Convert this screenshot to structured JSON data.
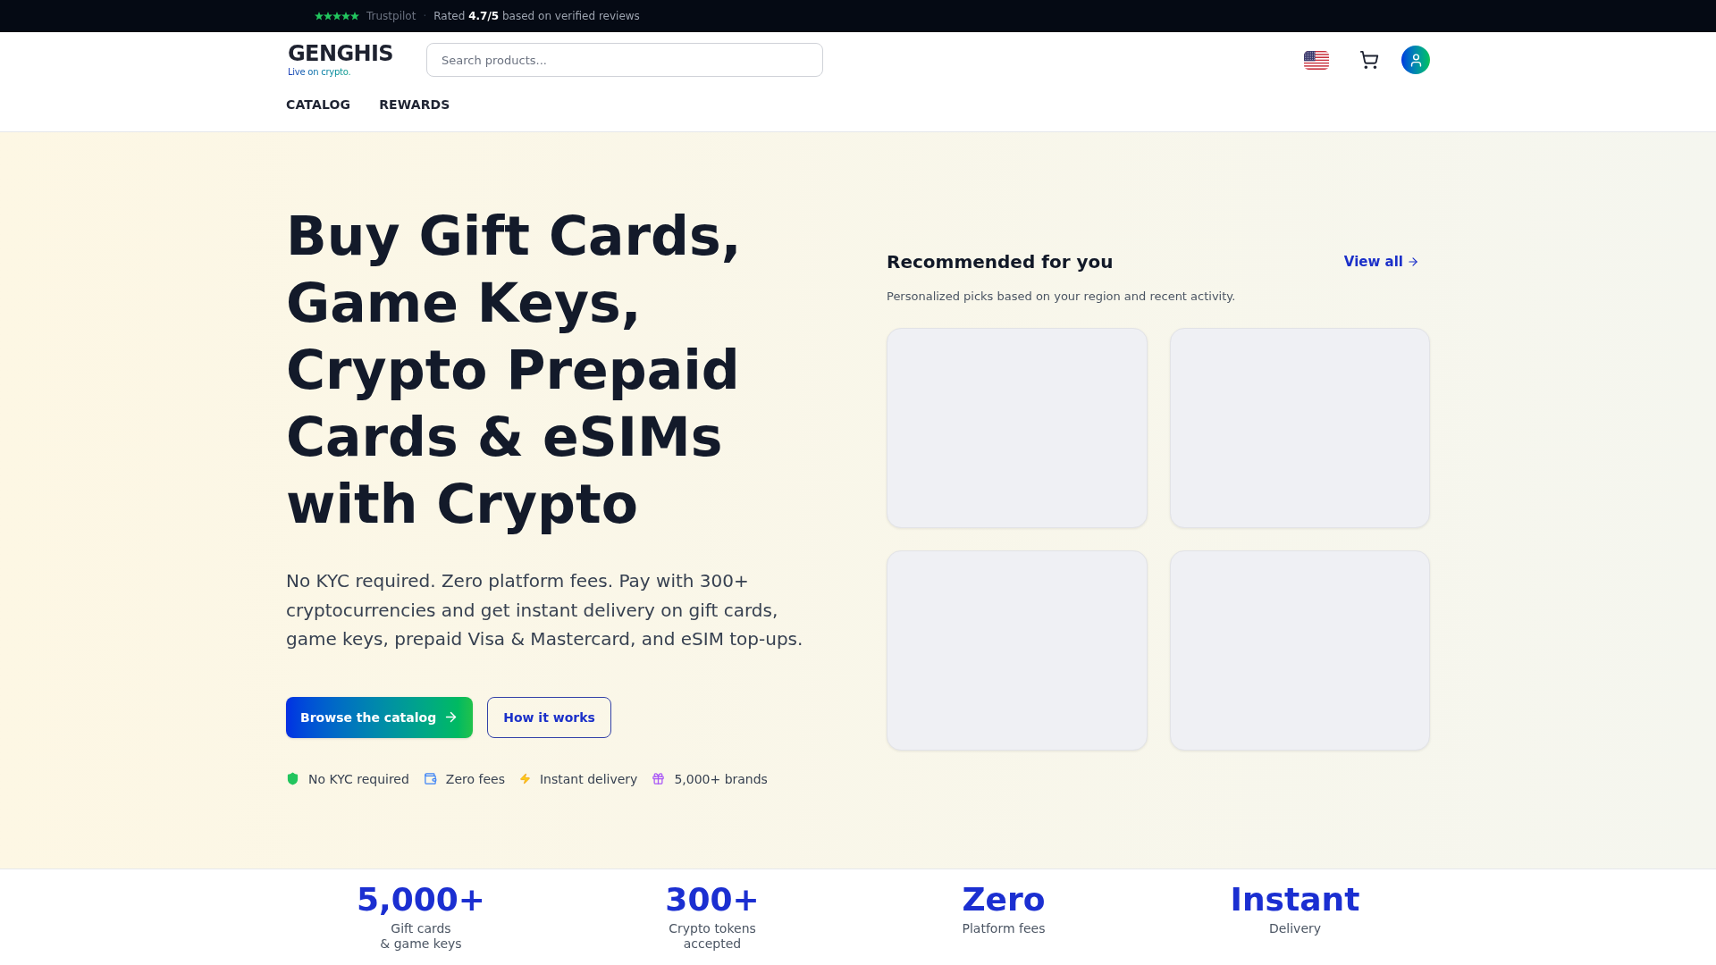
{
  "top_bar": {
    "stars": 5,
    "source": "Trustpilot",
    "separator": "·",
    "rating": "Rated **4.7/5** based on verified reviews"
  },
  "header": {
    "logo": {
      "wordmark": "GENGHIS",
      "tagline": "Live on crypto."
    },
    "search": {
      "placeholder": "Search products..."
    },
    "nav": [
      {
        "label": "CATALOG"
      },
      {
        "label": "REWARDS"
      }
    ]
  },
  "hero": {
    "title": "Buy Gift Cards, Game Keys, Crypto Prepaid Cards & eSIMs with Crypto",
    "description": "No KYC required. Zero platform fees. Pay with 300+ cryptocurrencies and get instant delivery on gift cards, game keys, prepaid Visa & Mastercard, and eSIM top-ups.",
    "buttons": [
      {
        "label": "Browse the catalog",
        "kind": "primary"
      },
      {
        "label": "How it works",
        "kind": "secondary"
      }
    ],
    "features": [
      {
        "label": "No KYC required",
        "kind": "shield"
      },
      {
        "label": "Zero fees",
        "kind": "wallet"
      },
      {
        "label": "Instant delivery",
        "kind": "bolt"
      },
      {
        "label": "5,000+ brands",
        "kind": "gift"
      }
    ]
  },
  "recommended": {
    "title": "Recommended for you",
    "link": "View all",
    "subtitle": "Personalized picks based on your region and recent activity.",
    "cards": [
      {
        "kind": "skeleton"
      },
      {
        "kind": "skeleton"
      },
      {
        "kind": "skeleton"
      },
      {
        "kind": "skeleton"
      }
    ]
  },
  "stats": [
    {
      "value": "5,000+",
      "label": "Gift cards\n& game keys"
    },
    {
      "value": "300+",
      "label": "Crypto tokens\naccepted"
    },
    {
      "value": "Zero",
      "label": "Platform fees"
    },
    {
      "value": "Instant",
      "label": "Delivery"
    }
  ]
}
